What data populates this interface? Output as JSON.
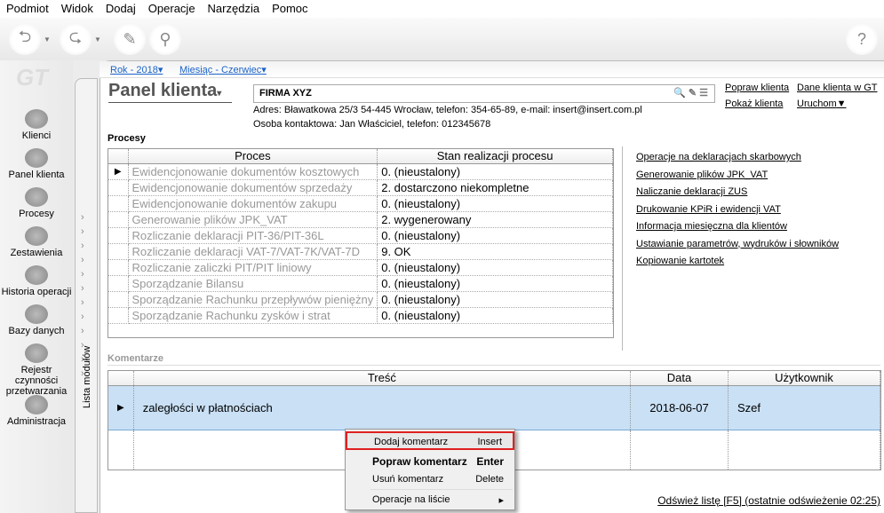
{
  "menu": [
    "Podmiot",
    "Widok",
    "Dodaj",
    "Operacje",
    "Narzędzia",
    "Pomoc"
  ],
  "logo": "GT",
  "modules_strip": "Lista modułów",
  "modules": [
    "Klienci",
    "Panel klienta",
    "Procesy",
    "Zestawienia",
    "Historia operacji",
    "Bazy danych",
    "Rejestr czynności przetwarzania",
    "Administracja"
  ],
  "period": {
    "year": "Rok - 2018",
    "month": "Miesiąc - Czerwiec"
  },
  "panel": {
    "title": "Panel klienta",
    "firm": "FIRMA XYZ",
    "address": "Adres: Bławatkowa 25/3 54-445 Wrocław, telefon: 354-65-89, e-mail: insert@insert.com.pl",
    "contact": "Osoba kontaktowa: Jan Właściciel, telefon: 012345678",
    "links": [
      "Popraw klienta",
      "Dane klienta w GT",
      "Pokaż klienta",
      "Uruchom"
    ]
  },
  "processes": {
    "label": "Procesy",
    "headers": [
      "Proces",
      "Stan realizacji procesu"
    ],
    "rows": [
      [
        "Ewidencjonowanie dokumentów kosztowych",
        "0. (nieustalony)"
      ],
      [
        "Ewidencjonowanie dokumentów sprzedaży",
        "2. dostarczono niekompletne"
      ],
      [
        "Ewidencjonowanie dokumentów zakupu",
        "0. (nieustalony)"
      ],
      [
        "Generowanie plików JPK_VAT",
        "2. wygenerowany"
      ],
      [
        "Rozliczanie deklaracji PIT-36/PIT-36L",
        "0. (nieustalony)"
      ],
      [
        "Rozliczanie deklaracji VAT-7/VAT-7K/VAT-7D",
        "9. OK"
      ],
      [
        "Rozliczanie zaliczki PIT/PIT liniowy",
        "0. (nieustalony)"
      ],
      [
        "Sporządzanie Bilansu",
        "0. (nieustalony)"
      ],
      [
        "Sporządzanie Rachunku przepływów pieniężny",
        "0. (nieustalony)"
      ],
      [
        "Sporządzanie Rachunku zysków i strat",
        "0. (nieustalony)"
      ]
    ]
  },
  "operations": [
    "Operacje na deklaracjach skarbowych",
    "Generowanie plików JPK_VAT",
    "Naliczanie deklaracji ZUS",
    "Drukowanie KPiR i ewidencji VAT",
    "Informacja miesięczna dla klientów",
    "Ustawianie parametrów, wydruków i słowników",
    "Kopiowanie kartotek"
  ],
  "comments": {
    "label": "Komentarze",
    "headers": [
      "Treść",
      "Data",
      "Użytkownik"
    ],
    "rows": [
      [
        "zaległości w płatnościach",
        "2018-06-07",
        "Szef"
      ]
    ]
  },
  "context_menu": [
    {
      "label": "Dodaj komentarz",
      "key": "Insert"
    },
    {
      "label": "Popraw komentarz",
      "key": "Enter"
    },
    {
      "label": "Usuń komentarz",
      "key": "Delete"
    },
    {
      "label": "Operacje na liście",
      "key": "▸"
    }
  ],
  "refresh": "Odśwież listę [F5] (ostatnie odświeżenie 02:25)"
}
